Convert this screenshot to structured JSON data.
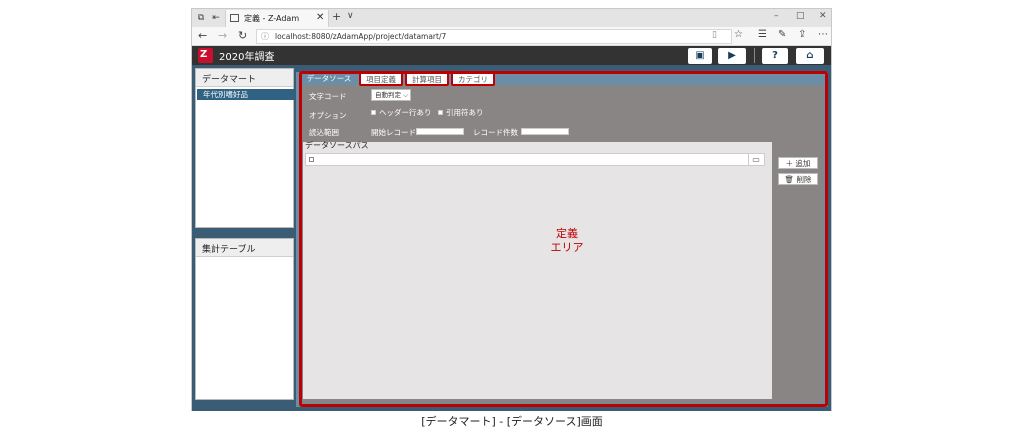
{
  "browser": {
    "tab_title": "定義 - Z-Adam",
    "tab_close": "✕",
    "new_tab": "+",
    "tab_menu": "∨",
    "window_controls": {
      "minimize": "–",
      "maximize": "□",
      "close": "✕"
    },
    "url": "localhost:8080/zAdamApp/project/datamart/7",
    "icons": [
      "back-icon",
      "forward-icon",
      "refresh-icon",
      "favorite-star-icon",
      "reading-list-icon",
      "pen-icon",
      "share-icon",
      "more-icon"
    ]
  },
  "app": {
    "title": "2020年調査",
    "accent_color": "#c00000",
    "header_color": "#333333"
  },
  "left": {
    "datamart_title": "データマート",
    "datamart_items": [
      "年代別嗜好品"
    ],
    "aggregate_title": "集計テーブル"
  },
  "main": {
    "tabs": [
      {
        "label": "データソース",
        "active": true
      },
      {
        "label": "項目定義",
        "active": false
      },
      {
        "label": "計算項目",
        "active": false
      },
      {
        "label": "カテゴリ",
        "active": false
      }
    ],
    "form": {
      "char_code_label": "文字コード",
      "char_code_value": "自動判定",
      "option_label": "オプション",
      "option_header": "ヘッダー行あり",
      "option_quote": "引用符あり",
      "range_label": "読込範囲",
      "start_record_label": "開始レコード",
      "record_count_label": "レコード件数"
    },
    "datasource_path_title": "データソースパス",
    "add_button": "＋ 追加",
    "delete_button": "🗑 削除",
    "annotation_line1": "定義",
    "annotation_line2": "エリア"
  },
  "caption": "[データマート] - [データソース]画面"
}
